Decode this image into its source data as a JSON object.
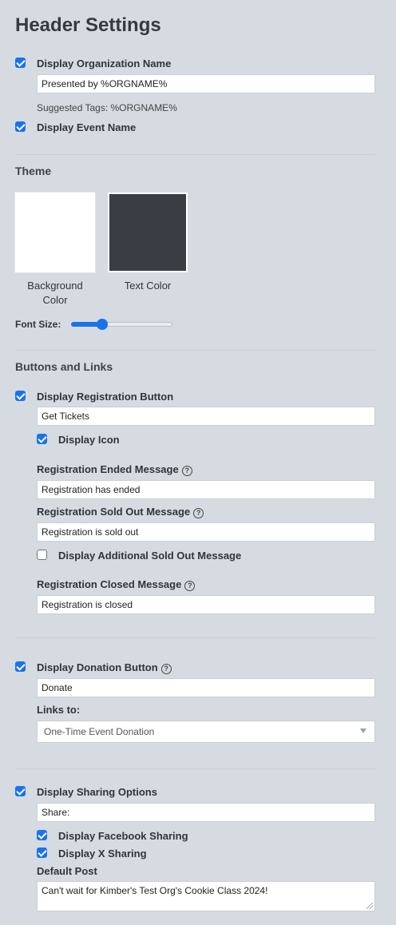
{
  "title": "Header Settings",
  "org": {
    "display_label": "Display Organization Name",
    "display_checked": true,
    "value": "Presented by %ORGNAME%",
    "suggested_tags": "Suggested Tags: %ORGNAME%"
  },
  "event_name": {
    "label": "Display Event Name",
    "checked": true
  },
  "theme": {
    "heading": "Theme",
    "background": {
      "caption": "Background Color",
      "color": "#ffffff"
    },
    "text": {
      "caption": "Text Color",
      "color": "#383e44"
    },
    "font_size_label": "Font Size:",
    "font_size_fraction": 0.28
  },
  "buttons_links": {
    "heading": "Buttons and Links",
    "registration": {
      "label": "Display Registration Button",
      "checked": true,
      "value": "Get Tickets",
      "display_icon_label": "Display Icon",
      "display_icon_checked": true,
      "ended_label": "Registration Ended Message",
      "ended_value": "Registration has ended",
      "sold_out_label": "Registration Sold Out Message",
      "sold_out_value": "Registration is sold out",
      "additional_sold_out_label": "Display Additional Sold Out Message",
      "additional_sold_out_checked": false,
      "closed_label": "Registration Closed Message",
      "closed_value": "Registration is closed"
    },
    "donation": {
      "label": "Display Donation Button",
      "checked": true,
      "value": "Donate",
      "links_to_label": "Links to:",
      "links_to_selected": "One-Time Event Donation"
    },
    "sharing": {
      "label": "Display Sharing Options",
      "checked": true,
      "value": "Share:",
      "facebook_label": "Display Facebook Sharing",
      "facebook_checked": true,
      "x_label": "Display X Sharing",
      "x_checked": true,
      "default_post_label": "Default Post",
      "default_post_value": "Can't wait for Kimber's Test Org's Cookie Class 2024!"
    }
  },
  "help_icon": "question-circle-icon"
}
